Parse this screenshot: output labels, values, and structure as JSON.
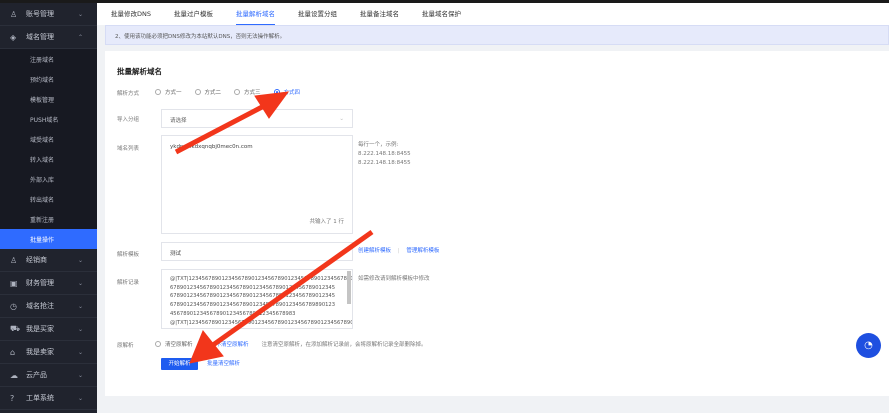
{
  "sidebar": {
    "top": [
      {
        "label": "账号管理",
        "icon": "user-icon"
      },
      {
        "label": "域名管理",
        "icon": "layers-icon"
      }
    ],
    "sub": [
      "注册域名",
      "预约域名",
      "模板管理",
      "PUSH域名",
      "域受域名",
      "转入域名",
      "外部入库",
      "转出域名",
      "重新注册",
      "批量操作"
    ],
    "bottom": [
      {
        "label": "经销商",
        "icon": "users-icon"
      },
      {
        "label": "财务管理",
        "icon": "wallet-icon"
      },
      {
        "label": "域名抢注",
        "icon": "clock-icon"
      },
      {
        "label": "我是买家",
        "icon": "cart-icon"
      },
      {
        "label": "我是卖家",
        "icon": "store-icon"
      },
      {
        "label": "云产品",
        "icon": "cloud-icon"
      },
      {
        "label": "工单系统",
        "icon": "help-icon"
      }
    ]
  },
  "tabs": [
    "批量修改DNS",
    "批量过户模板",
    "批量解析域名",
    "批量设置分组",
    "批量备注域名",
    "批量域名保护"
  ],
  "notice": "2、使用该功能必须把DNS修改为本站默认DNS，否则无法操作解析。",
  "form": {
    "title": "批量解析域名",
    "mode_label": "解析方式",
    "modes": [
      "方式一",
      "方式二",
      "方式三",
      "方式四"
    ],
    "group_label": "导入分组",
    "group_placeholder": "请选择",
    "list_label": "域名列表",
    "list_value": "ykdpylxkdxqnqbj0mec0n.com",
    "list_count": "共输入了 1 行",
    "list_hint": [
      "每行一个，示例:",
      "8.222.148.18:8455",
      "8.222.148.18:8455"
    ],
    "template_label": "解析模板",
    "template_value": "测试",
    "create_template": "创建解析模板",
    "sep": "|",
    "manage_template": "管理解析模板",
    "records_label": "解析记录",
    "records": [
      "@|TXT|12345678901234567890123456789012345678901234567890123456789012345",
      "67890123456789012345678901234567890123456789012345",
      "67890123456789012345678901234567890123456789012345",
      "67890123456789012345678901234567890123456789890123",
      "45678901234567890123456789012345678983",
      "@|TXT|12345678901234567890123456789012345678901234567890123456789012345"
    ],
    "records_hint": "如需修改请到解析模板中修改",
    "orig_label": "原解析",
    "clear": "清空原解析",
    "noclear": "不清空原解析",
    "orig_note": "注意清空原解析，在添加解析记录前，会将原解析记录全部删除掉。",
    "start": "开始解析",
    "batch_clear": "批量清空解析"
  },
  "colors": {
    "accent": "#2f6bff",
    "arrow": "#f2361b"
  }
}
